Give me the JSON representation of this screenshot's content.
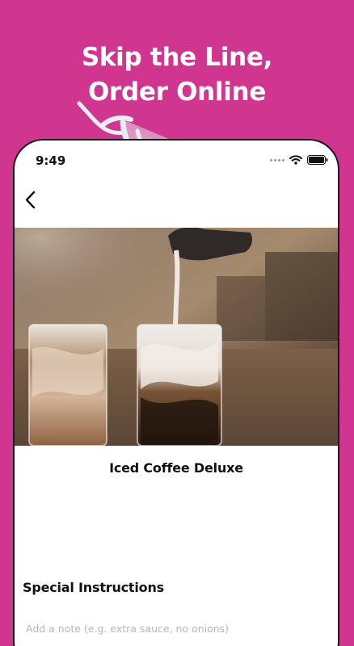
{
  "promo": {
    "headline_line1": "Skip the Line,",
    "headline_line2": "Order Online",
    "background_color": "#d0358f",
    "decoration_icon": "lemon-slice-icon"
  },
  "status_bar": {
    "time": "9:49",
    "icons": [
      "cellular-signal-icon",
      "wifi-icon",
      "battery-icon"
    ]
  },
  "nav": {
    "back_icon": "chevron-left-icon"
  },
  "product": {
    "image_subject": "iced-coffee-photo",
    "name": "Iced Coffee Deluxe"
  },
  "special_instructions": {
    "title": "Special Instructions",
    "placeholder": "Add a note (e.g. extra sauce, no onions)",
    "value": ""
  }
}
